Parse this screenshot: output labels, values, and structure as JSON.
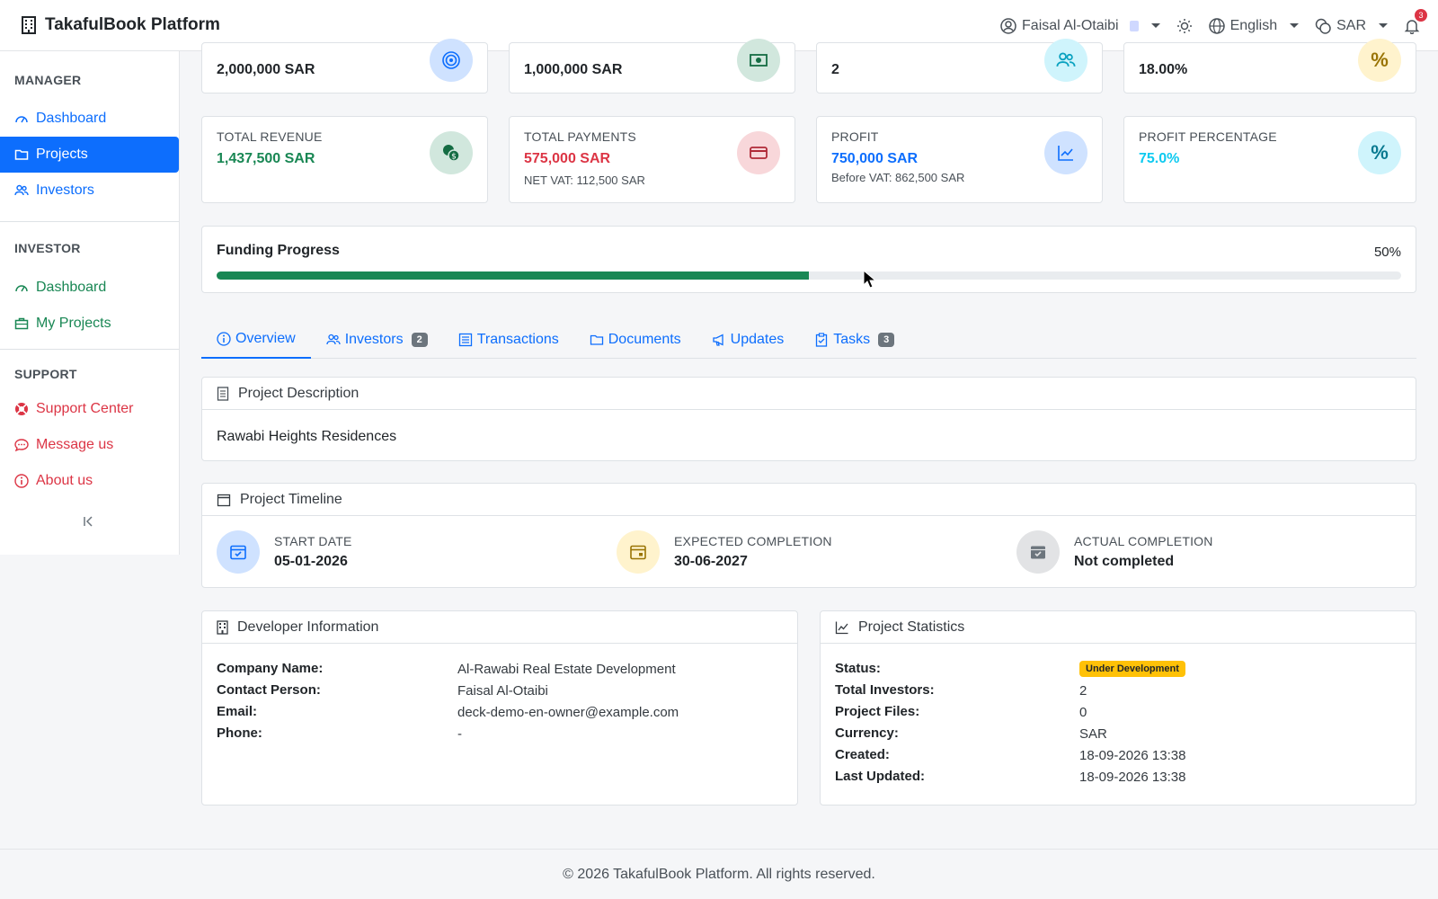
{
  "app": {
    "title": "TakafulBook Platform"
  },
  "topbar": {
    "user_name": "Faisal Al-Otaibi",
    "language": "English",
    "currency": "SAR",
    "notification_count": "3"
  },
  "sidebar": {
    "manager_title": "MANAGER",
    "manager_items": [
      {
        "label": "Dashboard",
        "icon": "gauge-icon"
      },
      {
        "label": "Projects",
        "icon": "folder-icon"
      },
      {
        "label": "Investors",
        "icon": "people-icon"
      }
    ],
    "investor_title": "INVESTOR",
    "investor_items": [
      {
        "label": "Dashboard",
        "icon": "gauge-icon"
      },
      {
        "label": "My Projects",
        "icon": "briefcase-icon"
      }
    ],
    "support_title": "SUPPORT",
    "support_items": [
      {
        "label": "Support Center",
        "icon": "lifebuoy-icon"
      },
      {
        "label": "Message us",
        "icon": "chat-icon"
      },
      {
        "label": "About us",
        "icon": "info-icon"
      }
    ]
  },
  "top_stats": [
    {
      "value": "2,000,000 SAR",
      "icon": "target-icon",
      "icon_bg": "#cfe2ff",
      "icon_color": "#0d6efd"
    },
    {
      "value": "1,000,000 SAR",
      "icon": "cash-icon",
      "icon_bg": "#d1e7dd",
      "icon_color": "#146c43"
    },
    {
      "value": "2",
      "icon": "people-icon",
      "icon_bg": "#cff4fc",
      "icon_color": "#0aa2c0"
    },
    {
      "value": "18.00%",
      "icon": "percent-icon",
      "icon_bg": "#fff3cd",
      "icon_color": "#997404"
    }
  ],
  "stats": [
    {
      "label": "TOTAL REVENUE",
      "value": "1,437,500 SAR",
      "value_color": "#198754",
      "sub": "",
      "icon": "coins-icon",
      "icon_bg": "#d1e7dd",
      "icon_color": "#146c43"
    },
    {
      "label": "TOTAL PAYMENTS",
      "value": "575,000 SAR",
      "value_color": "#dc3545",
      "sub": "NET VAT: 112,500 SAR",
      "icon": "credit-card-icon",
      "icon_bg": "#f8d7da",
      "icon_color": "#b02a37"
    },
    {
      "label": "PROFIT",
      "value": "750,000 SAR",
      "value_color": "#0d6efd",
      "sub": "Before VAT: 862,500 SAR",
      "icon": "chart-line-icon",
      "icon_bg": "#cfe2ff",
      "icon_color": "#0d6efd"
    },
    {
      "label": "PROFIT PERCENTAGE",
      "value": "75.0%",
      "value_color": "#0dcaf0",
      "sub": "",
      "icon": "percent-icon",
      "icon_bg": "#cff4fc",
      "icon_color": "#087990"
    }
  ],
  "funding": {
    "title": "Funding Progress",
    "percent_label": "50%",
    "progress": 0.5
  },
  "tabs": [
    {
      "label": "Overview",
      "icon": "info-icon",
      "badge": ""
    },
    {
      "label": "Investors",
      "icon": "people-icon",
      "badge": "2"
    },
    {
      "label": "Transactions",
      "icon": "list-icon",
      "badge": ""
    },
    {
      "label": "Documents",
      "icon": "folder-icon",
      "badge": ""
    },
    {
      "label": "Updates",
      "icon": "megaphone-icon",
      "badge": ""
    },
    {
      "label": "Tasks",
      "icon": "clipboard-icon",
      "badge": "3"
    }
  ],
  "description": {
    "title": "Project Description",
    "text": "Rawabi Heights Residences"
  },
  "timeline": {
    "title": "Project Timeline",
    "items": [
      {
        "label": "START DATE",
        "value": "05-01-2026",
        "icon_bg": "#cfe2ff",
        "icon_color": "#0d6efd"
      },
      {
        "label": "EXPECTED COMPLETION",
        "value": "30-06-2027",
        "icon_bg": "#fff3cd",
        "icon_color": "#997404"
      },
      {
        "label": "ACTUAL COMPLETION",
        "value": "Not completed",
        "icon_bg": "#e2e3e5",
        "icon_color": "#6c757d"
      }
    ]
  },
  "developer": {
    "title": "Developer Information",
    "rows": [
      {
        "key": "Company Name:",
        "value": "Al-Rawabi Real Estate Development"
      },
      {
        "key": "Contact Person:",
        "value": "Faisal Al-Otaibi"
      },
      {
        "key": "Email:",
        "value": "deck-demo-en-owner@example.com"
      },
      {
        "key": "Phone:",
        "value": "-"
      }
    ]
  },
  "statistics": {
    "title": "Project Statistics",
    "status_key": "Status:",
    "status_value": "Under Development",
    "rows": [
      {
        "key": "Total Investors:",
        "value": "2"
      },
      {
        "key": "Project Files:",
        "value": "0"
      },
      {
        "key": "Currency:",
        "value": "SAR"
      },
      {
        "key": "Created:",
        "value": "18-09-2026 13:38"
      },
      {
        "key": "Last Updated:",
        "value": "18-09-2026 13:38"
      }
    ]
  },
  "footer": {
    "text": "© 2026 TakafulBook Platform. All rights reserved."
  }
}
